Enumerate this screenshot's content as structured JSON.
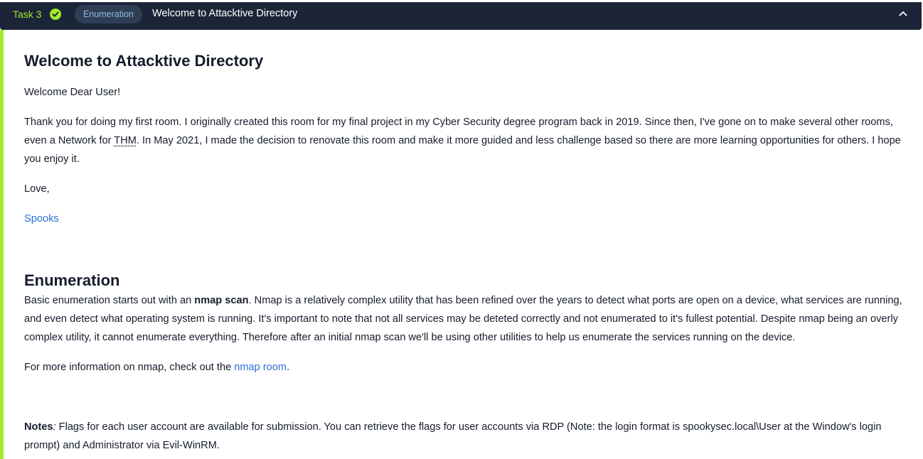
{
  "header": {
    "task_label": "Task 3",
    "tag": "Enumeration",
    "title": "Welcome to Attacktive Directory",
    "status_icon": "check-circle-icon",
    "toggle_icon": "chevron-up-icon"
  },
  "colors": {
    "header_bg": "#1c2538",
    "accent_green": "#a3ea2a",
    "link": "#2f6ed8",
    "badge_bg": "#2f3e55",
    "badge_text": "#8fb9e2"
  },
  "content": {
    "heading_welcome": "Welcome to Attacktive Directory",
    "greeting": "Welcome Dear User!",
    "thanks_part1": "Thank you for doing my first room. I originally created this room for my final project in my Cyber Security degree program back in 2019. Since then, I've gone on to make several other rooms, even a Network for ",
    "thanks_abbr": "THM",
    "thanks_part2": ". In May 2021, I made the decision to renovate this room and make it more guided and less challenge based so there are more learning opportunities for others. I hope you enjoy it.",
    "love": "Love,",
    "signature_link": "Spooks",
    "heading_enumeration": "Enumeration",
    "enum_part1": "Basic enumeration starts out with an ",
    "enum_bold": "nmap scan",
    "enum_part2": ". Nmap is a relatively complex utility that has been refined over the years to detect what ports are open on a device, what services are running, and even detect what operating system is running. It's important to note that not all services may be deteted correctly and not enumerated to it's fullest potential. Despite nmap being an overly complex utility, it cannot enumerate everything. Therefore after an initial nmap scan we'll be using other utilities to help us enumerate the services running on the device.",
    "nmap_part1": "For more information on nmap, check out the ",
    "nmap_link": "nmap room",
    "nmap_part2": ".",
    "notes_bold": "Notes",
    "notes_colon": ":",
    "notes_text": " Flags for each user account are available for submission. You can retrieve the flags for user accounts via RDP (Note: the login format is spookysec.local\\User at the Window's login prompt) and Administrator via Evil-WinRM."
  }
}
